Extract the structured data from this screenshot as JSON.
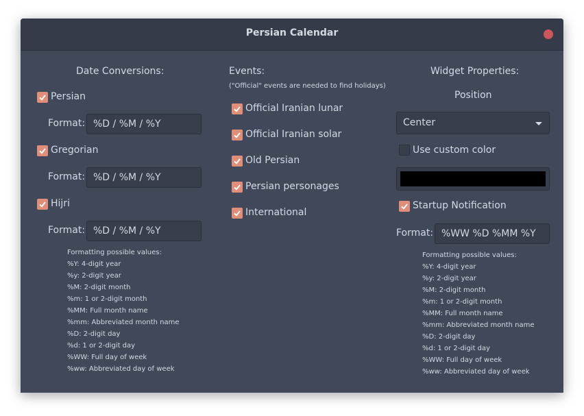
{
  "window": {
    "title": "Persian Calendar"
  },
  "conversions": {
    "heading": "Date Conversions:",
    "format_label": "Format:",
    "items": [
      {
        "label": "Persian",
        "checked": true,
        "format": "%D / %M / %Y"
      },
      {
        "label": "Gregorian",
        "checked": true,
        "format": "%D / %M / %Y"
      },
      {
        "label": "Hijri",
        "checked": true,
        "format": "%D / %M / %Y"
      }
    ],
    "help": [
      "Formatting possible values:",
      "%Y: 4-digit year",
      "%y: 2-digit year",
      "%M: 2-digit month",
      "%m: 1 or 2-digit month",
      "%MM: Full month name",
      "%mm: Abbreviated month name",
      "%D: 2-digit day",
      "%d: 1 or 2-digit day",
      "%WW: Full day of week",
      "%ww: Abbreviated day of week"
    ]
  },
  "events": {
    "heading": "Events:",
    "note": "(\"Official\" events are needed to find holidays)",
    "items": [
      {
        "label": "Official Iranian lunar",
        "checked": true
      },
      {
        "label": "Official Iranian solar",
        "checked": true
      },
      {
        "label": "Old Persian",
        "checked": true
      },
      {
        "label": "Persian personages",
        "checked": true
      },
      {
        "label": "International",
        "checked": true
      }
    ]
  },
  "widget": {
    "heading": "Widget Properties:",
    "position_label": "Position",
    "position_value": "Center",
    "custom_color_label": "Use custom color",
    "custom_color_checked": false,
    "custom_color": "#000000",
    "startup_label": "Startup Notification",
    "startup_checked": true,
    "format_label": "Format:",
    "format_value": "%WW %D %MM %Y",
    "help": [
      "Formatting possible values:",
      "%Y: 4-digit year",
      "%y: 2-digit year",
      "%M: 2-digit month",
      "%m: 1 or 2-digit month",
      "%MM: Full month name",
      "%mm: Abbreviated month name",
      "%D: 2-digit day",
      "%d: 1 or 2-digit day",
      "%WW: Full day of week",
      "%ww: Abbreviated day of week"
    ]
  },
  "colors": {
    "window_bg": "#404859",
    "titlebar_bg": "#353b48",
    "accent": "#e08e79",
    "close": "#cc575d",
    "text": "#d3dae3"
  },
  "icons": {
    "check": "check-icon",
    "close": "close-icon",
    "dropdown": "chevron-down-icon"
  }
}
